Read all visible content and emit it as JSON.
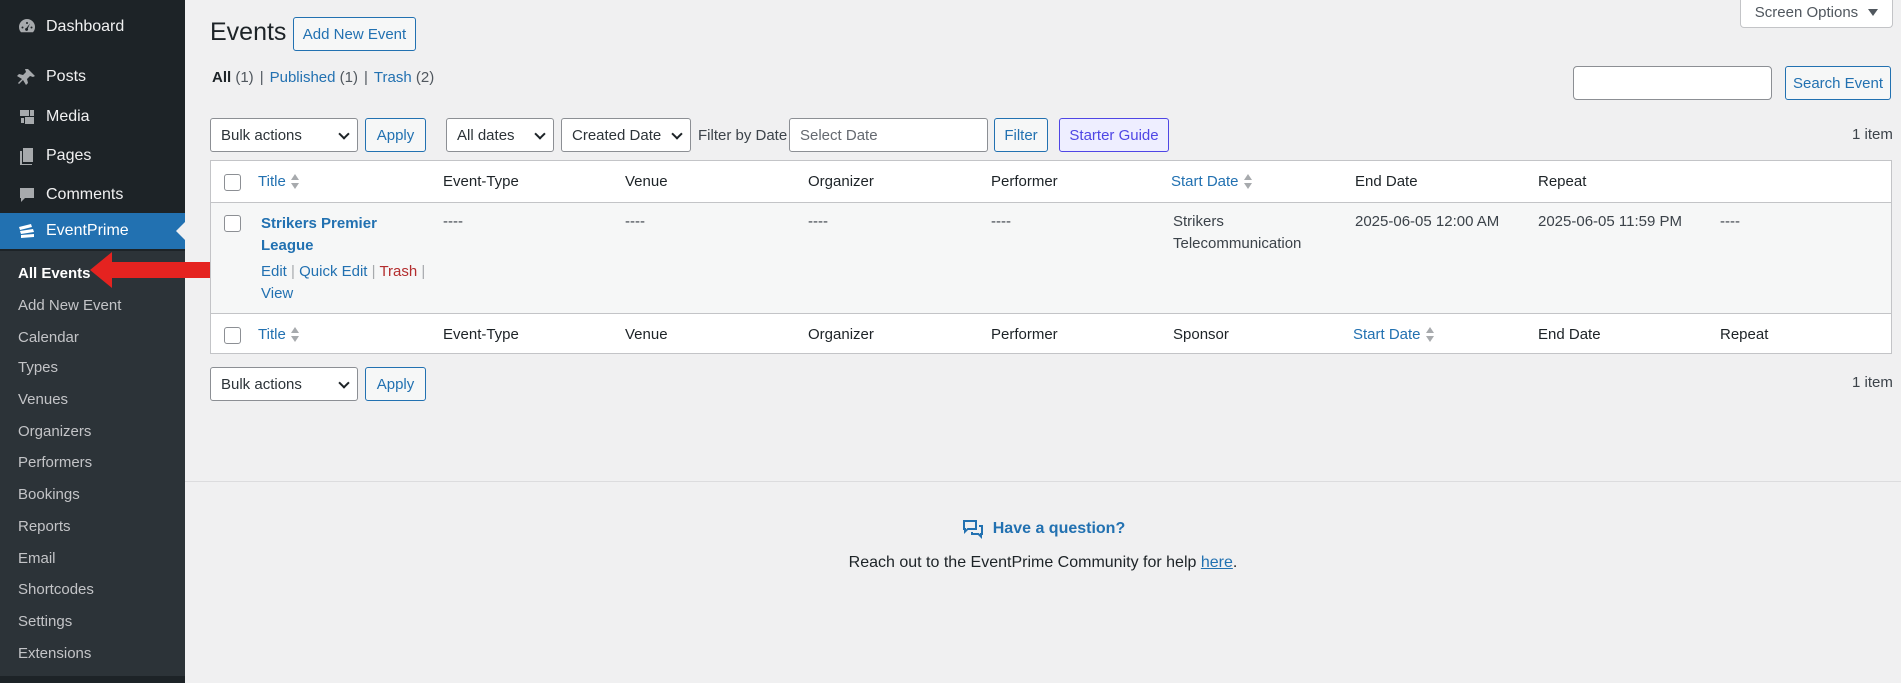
{
  "sidebar": {
    "items": [
      {
        "label": "Dashboard",
        "icon": "dashboard-icon"
      },
      {
        "label": "Posts",
        "icon": "pin-icon"
      },
      {
        "label": "Media",
        "icon": "media-icon"
      },
      {
        "label": "Pages",
        "icon": "pages-icon"
      },
      {
        "label": "Comments",
        "icon": "comments-icon"
      },
      {
        "label": "EventPrime",
        "icon": "eventprime-icon"
      }
    ],
    "submenu": [
      "All Events",
      "Add New Event",
      "Calendar",
      "Types",
      "Venues",
      "Organizers",
      "Performers",
      "Bookings",
      "Reports",
      "Email",
      "Shortcodes",
      "Settings",
      "Extensions"
    ]
  },
  "header": {
    "title": "Events",
    "add_new": "Add New Event",
    "screen_options": "Screen Options"
  },
  "views": {
    "all": "All",
    "all_count": "(1)",
    "published": "Published",
    "published_count": "(1)",
    "trash": "Trash",
    "trash_count": "(2)",
    "sep": "|"
  },
  "search": {
    "button": "Search Event"
  },
  "toolbar": {
    "bulk_actions": "Bulk actions",
    "apply": "Apply",
    "all_dates": "All dates",
    "created_date": "Created Date",
    "filter_by_date": "Filter by Date",
    "date_placeholder": "Select Date",
    "filter": "Filter",
    "starter_guide": "Starter Guide",
    "item_count": "1 item"
  },
  "table": {
    "top_headers": [
      "Title",
      "Event-Type",
      "Venue",
      "Organizer",
      "Performer",
      "Start Date",
      "End Date",
      "Repeat"
    ],
    "bottom_headers": [
      "Title",
      "Event-Type",
      "Venue",
      "Organizer",
      "Performer",
      "Sponsor",
      "Start Date",
      "End Date",
      "Repeat"
    ],
    "row": {
      "title": "Strikers Premier League",
      "event_type": "----",
      "venue": "----",
      "organizer": "----",
      "performer": "----",
      "sponsor": "Strikers Telecommunication",
      "start_date": "2025-06-05 12:00 AM",
      "end_date": "2025-06-05 11:59 PM",
      "repeat": "----",
      "actions": {
        "edit": "Edit",
        "quick_edit": "Quick Edit",
        "trash": "Trash",
        "view": "View",
        "sep": "|"
      }
    }
  },
  "help": {
    "title": "Have a question?",
    "text": "Reach out to the EventPrime Community for help",
    "link": "here",
    "period": "."
  },
  "colors": {
    "accent": "#2271b1",
    "sidebar": "#1d2327",
    "annotation_arrow": "#e52320"
  }
}
